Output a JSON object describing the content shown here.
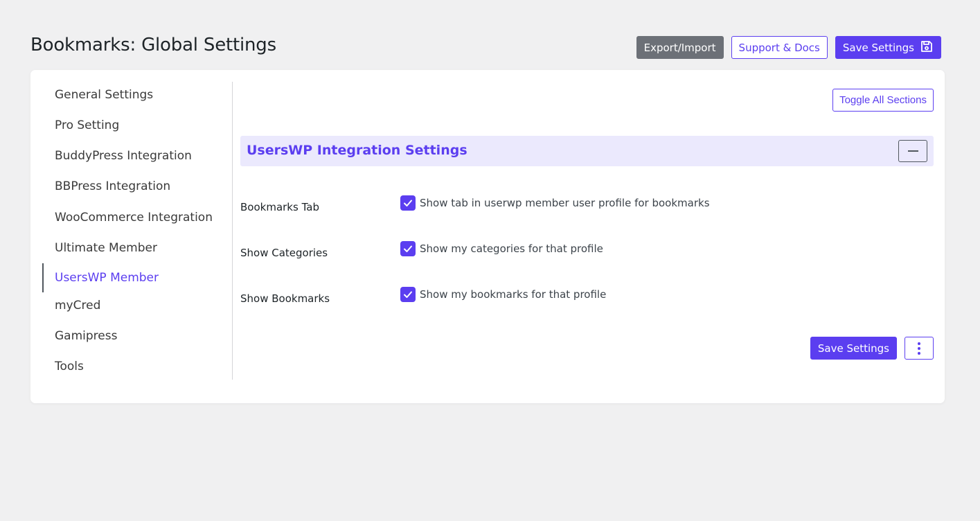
{
  "header": {
    "title": "Bookmarks: Global Settings",
    "export_import_label": "Export/Import",
    "support_docs_label": "Support & Docs",
    "save_settings_label": "Save Settings",
    "save_icon": "floppy-disk-icon"
  },
  "sidebar": {
    "items": [
      {
        "label": "General Settings",
        "active": false
      },
      {
        "label": "Pro Setting",
        "active": false
      },
      {
        "label": "BuddyPress Integration",
        "active": false
      },
      {
        "label": "BBPress Integration",
        "active": false
      },
      {
        "label": "WooCommerce Integration",
        "active": false
      },
      {
        "label": "Ultimate Member",
        "active": false
      },
      {
        "label": "UsersWP Member",
        "active": true
      },
      {
        "label": "myCred",
        "active": false
      },
      {
        "label": "Gamipress",
        "active": false
      },
      {
        "label": "Tools",
        "active": false
      }
    ]
  },
  "content": {
    "toggle_all_label": "Toggle All Sections",
    "section_title": "UsersWP Integration Settings",
    "settings": [
      {
        "label": "Bookmarks Tab",
        "description": "Show tab in userwp member user profile for bookmarks",
        "checked": true
      },
      {
        "label": "Show Categories",
        "description": "Show my categories for that profile",
        "checked": true
      },
      {
        "label": "Show Bookmarks",
        "description": "Show my bookmarks for that profile",
        "checked": true
      }
    ],
    "save_settings_label": "Save Settings",
    "more_icon": "vertical-ellipsis-icon"
  },
  "colors": {
    "accent": "#5b3ef0",
    "section_bg": "#ebe9fd",
    "page_bg": "#f0f0f1",
    "gray_button": "#6c7077"
  }
}
